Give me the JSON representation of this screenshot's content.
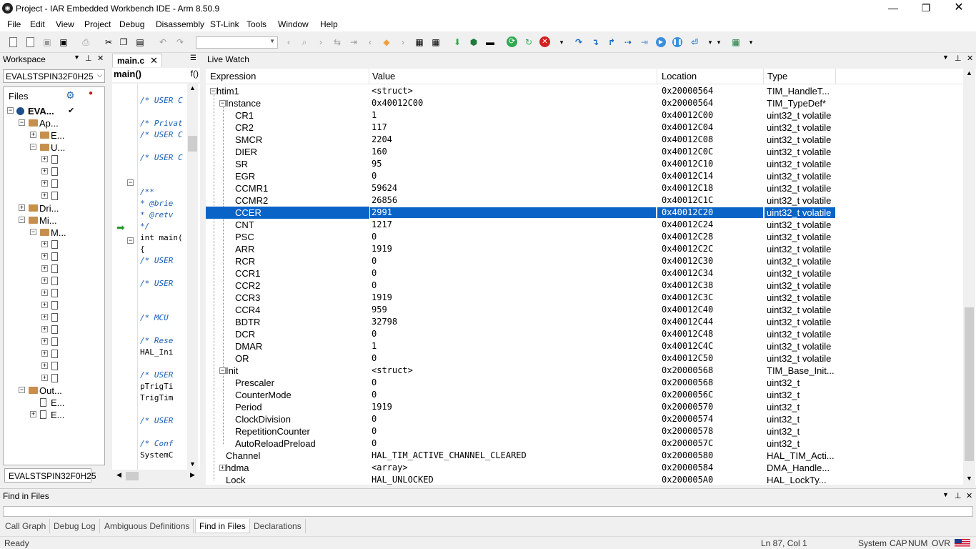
{
  "window": {
    "title": "Project - IAR Embedded Workbench IDE - Arm 8.50.9"
  },
  "menu": [
    "File",
    "Edit",
    "View",
    "Project",
    "Debug",
    "Disassembly",
    "ST-Link",
    "Tools",
    "Window",
    "Help"
  ],
  "workspace": {
    "header": "Workspace",
    "config": "EVALSTSPIN32F0H25",
    "files_label": "Files",
    "footer_tab": "EVALSTSPIN32F0H25",
    "tree": [
      {
        "label": "EVA...",
        "level": 0,
        "expander": "-",
        "icon": "project",
        "bold": true
      },
      {
        "label": "Ap...",
        "level": 1,
        "expander": "-",
        "icon": "folder"
      },
      {
        "label": "E...",
        "level": 2,
        "expander": "+",
        "icon": "folder"
      },
      {
        "label": "U...",
        "level": 2,
        "expander": "-",
        "icon": "folder"
      },
      {
        "label": "",
        "level": 3,
        "expander": "+",
        "icon": "file"
      },
      {
        "label": "",
        "level": 3,
        "expander": "+",
        "icon": "file"
      },
      {
        "label": "",
        "level": 3,
        "expander": "+",
        "icon": "file"
      },
      {
        "label": "",
        "level": 3,
        "expander": "+",
        "icon": "file"
      },
      {
        "label": "Dri...",
        "level": 1,
        "expander": "+",
        "icon": "folder"
      },
      {
        "label": "Mi...",
        "level": 1,
        "expander": "-",
        "icon": "folder"
      },
      {
        "label": "M...",
        "level": 2,
        "expander": "-",
        "icon": "folder"
      },
      {
        "label": "",
        "level": 3,
        "expander": "+",
        "icon": "file"
      },
      {
        "label": "",
        "level": 3,
        "expander": "+",
        "icon": "file"
      },
      {
        "label": "",
        "level": 3,
        "expander": "+",
        "icon": "file"
      },
      {
        "label": "",
        "level": 3,
        "expander": "+",
        "icon": "file"
      },
      {
        "label": "",
        "level": 3,
        "expander": "+",
        "icon": "file"
      },
      {
        "label": "",
        "level": 3,
        "expander": "+",
        "icon": "file"
      },
      {
        "label": "",
        "level": 3,
        "expander": "+",
        "icon": "file"
      },
      {
        "label": "",
        "level": 3,
        "expander": "+",
        "icon": "file"
      },
      {
        "label": "",
        "level": 3,
        "expander": "+",
        "icon": "file"
      },
      {
        "label": "",
        "level": 3,
        "expander": "+",
        "icon": "file"
      },
      {
        "label": "",
        "level": 3,
        "expander": "+",
        "icon": "file"
      },
      {
        "label": "",
        "level": 3,
        "expander": "+",
        "icon": "file"
      },
      {
        "label": "Out...",
        "level": 1,
        "expander": "-",
        "icon": "folder"
      },
      {
        "label": "E...",
        "level": 2,
        "expander": "",
        "icon": "doc"
      },
      {
        "label": "E...",
        "level": 2,
        "expander": "+",
        "icon": "doc"
      }
    ]
  },
  "editor": {
    "tab": "main.c",
    "function": "main()",
    "function_icon": "f()",
    "lines": [
      {
        "text": "/* USER C",
        "comment": true
      },
      {
        "text": "",
        "comment": false
      },
      {
        "text": "/* Privat",
        "comment": true
      },
      {
        "text": "/* USER C",
        "comment": true
      },
      {
        "text": "",
        "comment": false
      },
      {
        "text": "/* USER C",
        "comment": true
      },
      {
        "text": "",
        "comment": false
      },
      {
        "text": "",
        "comment": false
      },
      {
        "text": "/**",
        "comment": true
      },
      {
        "text": "  * @brie",
        "comment": true
      },
      {
        "text": "  * @retv",
        "comment": true
      },
      {
        "text": "  */",
        "comment": true
      },
      {
        "text": "int main(",
        "comment": false
      },
      {
        "text": "{",
        "comment": false
      },
      {
        "text": "  /* USER",
        "comment": true
      },
      {
        "text": "",
        "comment": false
      },
      {
        "text": "  /* USER",
        "comment": true
      },
      {
        "text": "",
        "comment": false
      },
      {
        "text": "",
        "comment": false
      },
      {
        "text": "  /* MCU",
        "comment": true
      },
      {
        "text": "",
        "comment": false
      },
      {
        "text": "  /* Rese",
        "comment": true
      },
      {
        "text": "  HAL_Ini",
        "comment": false
      },
      {
        "text": "",
        "comment": false
      },
      {
        "text": "  /* USER",
        "comment": true
      },
      {
        "text": "  pTrigTi",
        "comment": false
      },
      {
        "text": "  TrigTim",
        "comment": false
      },
      {
        "text": "",
        "comment": false
      },
      {
        "text": "  /* USER",
        "comment": true
      },
      {
        "text": "",
        "comment": false
      },
      {
        "text": "  /* Conf",
        "comment": true
      },
      {
        "text": "  SystemC",
        "comment": false
      },
      {
        "text": "",
        "comment": false
      },
      {
        "text": "  /* USER",
        "comment": true
      }
    ]
  },
  "live_watch": {
    "title": "Live Watch",
    "columns": [
      "Expression",
      "Value",
      "Location",
      "Type"
    ],
    "rows": [
      {
        "expr": "htim1",
        "indent": 0,
        "exp": "-",
        "value": "<struct>",
        "loc": "0x20000564",
        "type": "TIM_HandleT..."
      },
      {
        "expr": "Instance",
        "indent": 1,
        "exp": "-",
        "value": "0x40012C00",
        "loc": "0x20000564",
        "type": "TIM_TypeDef*"
      },
      {
        "expr": "CR1",
        "indent": 2,
        "exp": "",
        "value": "1",
        "loc": "0x40012C00",
        "type": "uint32_t volatile"
      },
      {
        "expr": "CR2",
        "indent": 2,
        "exp": "",
        "value": "117",
        "loc": "0x40012C04",
        "type": "uint32_t volatile"
      },
      {
        "expr": "SMCR",
        "indent": 2,
        "exp": "",
        "value": "2204",
        "loc": "0x40012C08",
        "type": "uint32_t volatile"
      },
      {
        "expr": "DIER",
        "indent": 2,
        "exp": "",
        "value": "160",
        "loc": "0x40012C0C",
        "type": "uint32_t volatile"
      },
      {
        "expr": "SR",
        "indent": 2,
        "exp": "",
        "value": "95",
        "loc": "0x40012C10",
        "type": "uint32_t volatile"
      },
      {
        "expr": "EGR",
        "indent": 2,
        "exp": "",
        "value": "0",
        "loc": "0x40012C14",
        "type": "uint32_t volatile"
      },
      {
        "expr": "CCMR1",
        "indent": 2,
        "exp": "",
        "value": "59624",
        "loc": "0x40012C18",
        "type": "uint32_t volatile"
      },
      {
        "expr": "CCMR2",
        "indent": 2,
        "exp": "",
        "value": "26856",
        "loc": "0x40012C1C",
        "type": "uint32_t volatile"
      },
      {
        "expr": "CCER",
        "indent": 2,
        "exp": "",
        "value": "2991",
        "loc": "0x40012C20",
        "type": "uint32_t volatile",
        "selected": true
      },
      {
        "expr": "CNT",
        "indent": 2,
        "exp": "",
        "value": "1217",
        "loc": "0x40012C24",
        "type": "uint32_t volatile"
      },
      {
        "expr": "PSC",
        "indent": 2,
        "exp": "",
        "value": "0",
        "loc": "0x40012C28",
        "type": "uint32_t volatile"
      },
      {
        "expr": "ARR",
        "indent": 2,
        "exp": "",
        "value": "1919",
        "loc": "0x40012C2C",
        "type": "uint32_t volatile"
      },
      {
        "expr": "RCR",
        "indent": 2,
        "exp": "",
        "value": "0",
        "loc": "0x40012C30",
        "type": "uint32_t volatile"
      },
      {
        "expr": "CCR1",
        "indent": 2,
        "exp": "",
        "value": "0",
        "loc": "0x40012C34",
        "type": "uint32_t volatile"
      },
      {
        "expr": "CCR2",
        "indent": 2,
        "exp": "",
        "value": "0",
        "loc": "0x40012C38",
        "type": "uint32_t volatile"
      },
      {
        "expr": "CCR3",
        "indent": 2,
        "exp": "",
        "value": "1919",
        "loc": "0x40012C3C",
        "type": "uint32_t volatile"
      },
      {
        "expr": "CCR4",
        "indent": 2,
        "exp": "",
        "value": "959",
        "loc": "0x40012C40",
        "type": "uint32_t volatile"
      },
      {
        "expr": "BDTR",
        "indent": 2,
        "exp": "",
        "value": "32798",
        "loc": "0x40012C44",
        "type": "uint32_t volatile"
      },
      {
        "expr": "DCR",
        "indent": 2,
        "exp": "",
        "value": "0",
        "loc": "0x40012C48",
        "type": "uint32_t volatile"
      },
      {
        "expr": "DMAR",
        "indent": 2,
        "exp": "",
        "value": "1",
        "loc": "0x40012C4C",
        "type": "uint32_t volatile"
      },
      {
        "expr": "OR",
        "indent": 2,
        "exp": "",
        "value": "0",
        "loc": "0x40012C50",
        "type": "uint32_t volatile"
      },
      {
        "expr": "Init",
        "indent": 1,
        "exp": "-",
        "value": "<struct>",
        "loc": "0x20000568",
        "type": "TIM_Base_Init..."
      },
      {
        "expr": "Prescaler",
        "indent": 2,
        "exp": "",
        "value": "0",
        "loc": "0x20000568",
        "type": "uint32_t"
      },
      {
        "expr": "CounterMode",
        "indent": 2,
        "exp": "",
        "value": "0",
        "loc": "0x2000056C",
        "type": "uint32_t"
      },
      {
        "expr": "Period",
        "indent": 2,
        "exp": "",
        "value": "1919",
        "loc": "0x20000570",
        "type": "uint32_t"
      },
      {
        "expr": "ClockDivision",
        "indent": 2,
        "exp": "",
        "value": "0",
        "loc": "0x20000574",
        "type": "uint32_t"
      },
      {
        "expr": "RepetitionCounter",
        "indent": 2,
        "exp": "",
        "value": "0",
        "loc": "0x20000578",
        "type": "uint32_t"
      },
      {
        "expr": "AutoReloadPreload",
        "indent": 2,
        "exp": "",
        "value": "0",
        "loc": "0x2000057C",
        "type": "uint32_t"
      },
      {
        "expr": "Channel",
        "indent": 1,
        "exp": "",
        "value": "HAL_TIM_ACTIVE_CHANNEL_CLEARED",
        "loc": "0x20000580",
        "type": "HAL_TIM_Acti..."
      },
      {
        "expr": "hdma",
        "indent": 1,
        "exp": "+",
        "value": "<array>",
        "loc": "0x20000584",
        "type": "DMA_Handle..."
      },
      {
        "expr": "Lock",
        "indent": 1,
        "exp": "",
        "value": "HAL_UNLOCKED",
        "loc": "0x200005A0",
        "type": "HAL_LockTy..."
      }
    ]
  },
  "find_in_files": {
    "title": "Find in Files"
  },
  "bottom_tabs": [
    "Call Graph",
    "Debug Log",
    "Ambiguous Definitions",
    "Find in Files",
    "Declarations"
  ],
  "bottom_tab_active": 3,
  "status": {
    "left": "Ready",
    "position": "Ln 87, Col 1",
    "system": "System",
    "cap": "CAP",
    "num": "NUM",
    "ovr": "OVR"
  },
  "colors": {
    "selection": "#0a64c8",
    "comment": "#1a5fb4",
    "folder": "#c68f4e"
  }
}
